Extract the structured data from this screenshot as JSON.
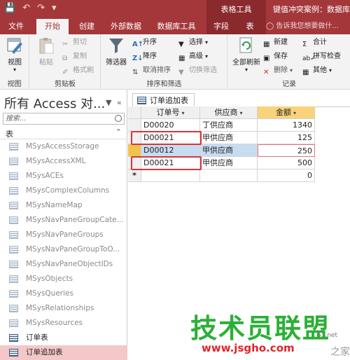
{
  "titlebar": {
    "qat_save": "💾",
    "qat_undo": "↶",
    "qat_redo": "↷",
    "qat_more": "▾",
    "contextual_tab": "表格工具",
    "doc_title": "键值冲突案例：数据库-"
  },
  "tabs": [
    "文件",
    "开始",
    "创建",
    "外部数据",
    "数据库工具",
    "字段",
    "表"
  ],
  "tell_me": "告诉我您想要做什...",
  "ribbon": {
    "view": "视图",
    "view_group": "视图",
    "paste": "粘贴",
    "cut": "剪切",
    "copy": "复制",
    "format_painter": "格式刷",
    "clipboard_group": "剪贴板",
    "filter": "筛选器",
    "ascending": "升序",
    "descending": "降序",
    "remove_sort": "取消排序",
    "selection": "选择",
    "advanced": "高级",
    "toggle_filter": "切换筛选",
    "sort_group": "排序和筛选",
    "refresh_all": "全部刷新",
    "new": "新建",
    "save": "保存",
    "delete": "删除",
    "totals": "合计",
    "spelling": "拼写检查",
    "more": "其他",
    "records_group": "记录"
  },
  "navpane": {
    "title": "所有 Access 对...",
    "search_placeholder": "搜索...",
    "group": "表",
    "items": [
      "MSysAccessStorage",
      "MSysAccessXML",
      "MSysACEs",
      "MSysComplexColumns",
      "MSysNameMap",
      "MSysNavPaneGroupCate...",
      "MSysNavPaneGroups",
      "MSysNavPaneGroupToO...",
      "MSysNavPaneObjectIDs",
      "MSysObjects",
      "MSysQueries",
      "MSysRelationships",
      "MSysResources",
      "订单表",
      "订单追加表"
    ]
  },
  "document": {
    "tab_label": "订单追加表",
    "columns": [
      "订单号",
      "供应商",
      "金额"
    ],
    "rows": [
      [
        "D00020",
        "丁供应商",
        "1340"
      ],
      [
        "D00021",
        "甲供应商",
        "125"
      ],
      [
        "D00012",
        "甲供应商",
        "250"
      ],
      [
        "D00021",
        "甲供应商",
        "500"
      ]
    ],
    "new_row_marker": "*",
    "new_row_amount": "0"
  },
  "watermark": {
    "main": "技术员联盟",
    "url": "www.jsgho.com",
    "side": "51.net",
    "side2": "之家"
  },
  "colors": {
    "accent": "#a4373a",
    "selected_nav": "#f4c7c8",
    "highlight": "#c8dcf1",
    "red_box": "#d9353a"
  }
}
